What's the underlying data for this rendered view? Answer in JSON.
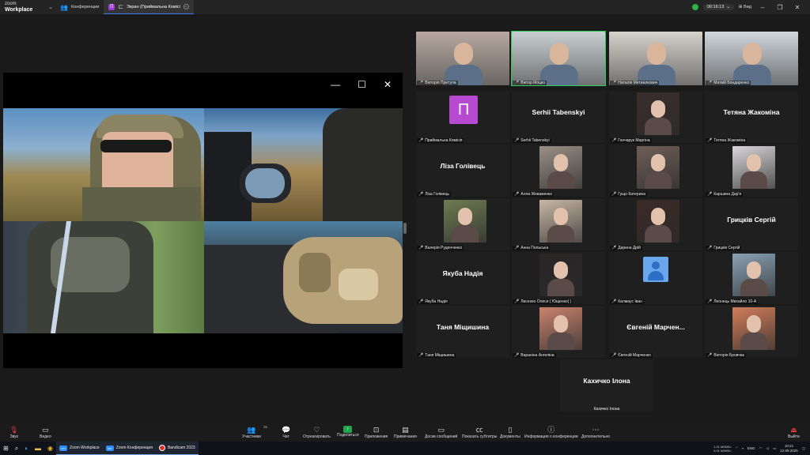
{
  "app": {
    "logo_top": "zoom",
    "logo_bottom": "Workplace",
    "tabs": [
      {
        "label": "Конференции",
        "icon": "people-icon"
      },
      {
        "label": "Экран (Приймальна Комісі",
        "icon": "share-screen-icon"
      }
    ],
    "timer": "00:16:13",
    "view_label": "Вид"
  },
  "gallery": {
    "video_tiles": [
      {
        "name": "Вікторія Притула",
        "color": "#b7a9a0"
      },
      {
        "name": "Віктор Моцко",
        "color": "#c9d0d2"
      },
      {
        "name": "Наталія Метиалкович",
        "color": "#d6d2cc"
      },
      {
        "name": "Матвій Бондаренко",
        "color": "#cfd6dc"
      }
    ],
    "tiles": [
      {
        "kind": "initial",
        "initial": "П",
        "label": "Приймальна Комісія"
      },
      {
        "kind": "text",
        "bigname": "Serhii Tabenskyi",
        "label": "Serhii Tabenskyi"
      },
      {
        "kind": "photo",
        "label": "Гончарук Маргіна",
        "color": "#3a2e2c"
      },
      {
        "kind": "text",
        "bigname": "Тетяна Жакоміна",
        "label": "Тетяна Жакоміна"
      },
      {
        "kind": "text",
        "bigname": "Ліза Голівець",
        "label": "Ліза Голівець"
      },
      {
        "kind": "photo",
        "label": "Алла Жеваженко",
        "color": "#9a8f86"
      },
      {
        "kind": "photo",
        "label": "Гущо Катерина",
        "color": "#6f5e57"
      },
      {
        "kind": "photo",
        "label": "Каршина Дар'я",
        "color": "#d8d6d8"
      },
      {
        "kind": "photo",
        "label": "Валерія Руденченко",
        "color": "#6d7a52"
      },
      {
        "kind": "photo",
        "label": "Анна Польська",
        "color": "#c8b7a6"
      },
      {
        "kind": "photo",
        "label": "Дарина Дрій",
        "color": "#3b2a26"
      },
      {
        "kind": "text",
        "bigname": "Грицків Сергій",
        "label": "Грицків Сергій"
      },
      {
        "kind": "text",
        "bigname": "Якуба Надія",
        "label": "Якуба Надія"
      },
      {
        "kind": "photo",
        "label": "Лисенко Олеся ( Ющенко( )",
        "color": "#2a2526"
      },
      {
        "kind": "avatar",
        "label": "Калмаус Іван"
      },
      {
        "kind": "photo",
        "label": "Леонець Михайло 10-А",
        "color": "#8aa2b5"
      },
      {
        "kind": "text",
        "bigname": "Таня Міщишина",
        "label": "Таня Міщишина"
      },
      {
        "kind": "photo",
        "label": "Вараніна Ангеліна",
        "color": "#c9826e"
      },
      {
        "kind": "text",
        "bigname": "Євгеній Марчен...",
        "label": "Євгеній Марченко"
      },
      {
        "kind": "photo",
        "label": "Вікторія Бровчак",
        "color": "#d07d5a"
      }
    ],
    "last_tile": {
      "bigname": "Кахичко Ілона",
      "label": "Кахичко Ілона"
    }
  },
  "toolbar": {
    "audio": "Звук",
    "video": "Видео",
    "participants": "Участники",
    "participants_count": "25",
    "chat": "Чат",
    "react": "Отреагировать",
    "share": "Поделиться",
    "apps": "Приложения",
    "notes": "Примечания",
    "whiteboards": "Доски сообщений",
    "captions": "Показать субтитры",
    "docs": "Документы",
    "info": "Информация о конференции",
    "more": "Дополнительно",
    "leave": "Выйти"
  },
  "taskbar": {
    "apps": [
      {
        "label": "Zoom Workplace"
      },
      {
        "label": "Zoom Конференция"
      },
      {
        "label": "Bandicam 2023"
      }
    ],
    "net_up": "1,01 МбКб/с",
    "net_down": "0,01 МбКб/с",
    "lang": "ENG",
    "time": "10:21",
    "date": "12.09.2025"
  }
}
